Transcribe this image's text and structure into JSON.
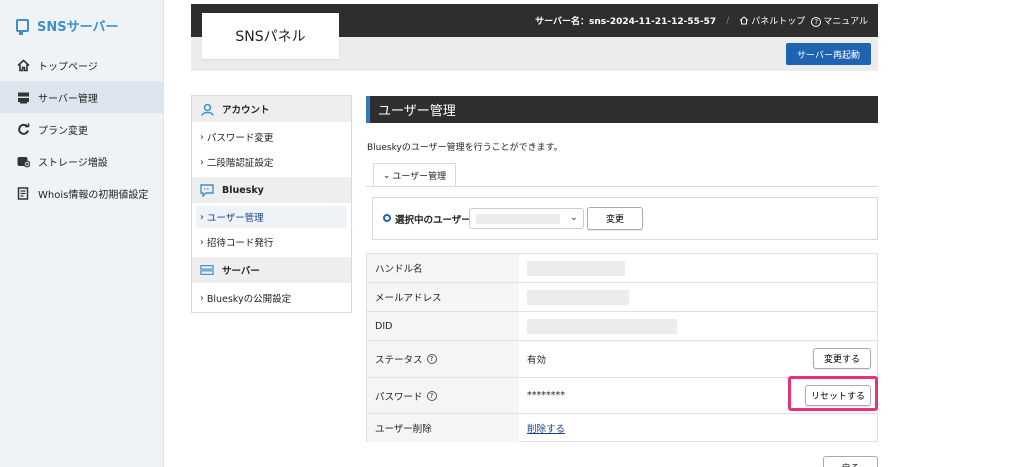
{
  "app": {
    "brand": "SNSサーバー"
  },
  "nav": {
    "items": [
      {
        "label": "トップページ",
        "icon": "home-icon"
      },
      {
        "label": "サーバー管理",
        "icon": "server-icon"
      },
      {
        "label": "プラン変更",
        "icon": "refresh-icon"
      },
      {
        "label": "ストレージ増設",
        "icon": "storage-icon"
      },
      {
        "label": "Whois情報の初期値設定",
        "icon": "document-icon"
      }
    ],
    "active_index": 1
  },
  "header": {
    "server_label": "サーバー名：sns-2024-11-21-12-55-57",
    "panel_top": "パネルトップ",
    "manual": "マニュアル",
    "logo": "SNSパネル",
    "restart_button": "サーバー再起動"
  },
  "submenu": {
    "account_heading": "アカウント",
    "account_items": [
      "パスワード変更",
      "二段階認証設定"
    ],
    "bluesky_heading": "Bluesky",
    "bluesky_items": [
      "ユーザー管理",
      "招待コード発行"
    ],
    "server_heading": "サーバー",
    "server_items": [
      "Blueskyの公開設定"
    ]
  },
  "main": {
    "title": "ユーザー管理",
    "description": "Blueskyのユーザー管理を行うことができます。",
    "tab": "ユーザー管理",
    "select_label": "選択中のユーザー",
    "select_value": "",
    "change_button": "変更",
    "rows": {
      "handle": {
        "label": "ハンドル名",
        "value": ""
      },
      "email": {
        "label": "メールアドレス",
        "value": ""
      },
      "did": {
        "label": "DID",
        "value": ""
      },
      "status": {
        "label": "ステータス",
        "value": "有効",
        "button": "変更する"
      },
      "password": {
        "label": "パスワード",
        "value": "********",
        "button": "リセットする"
      },
      "delete": {
        "label": "ユーザー削除",
        "link": "削除する"
      }
    },
    "back_button": "戻る"
  },
  "colors": {
    "accent": "#1f63b3",
    "highlight": "#e8317a",
    "brand": "#3f8fc9"
  }
}
